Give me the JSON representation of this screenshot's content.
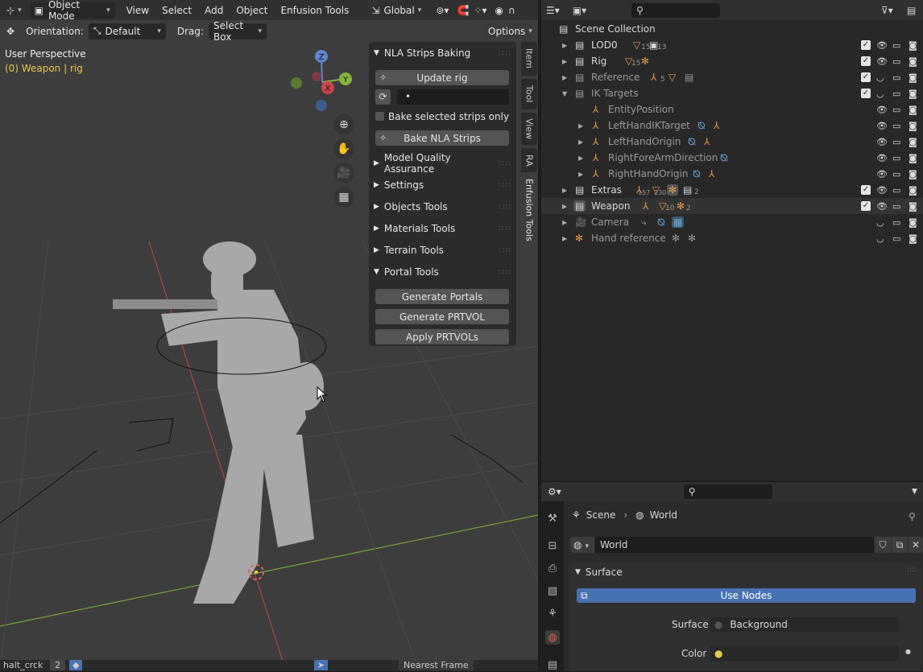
{
  "viewport": {
    "menus": [
      "View",
      "Select",
      "Add",
      "Object",
      "Enfusion Tools"
    ],
    "mode": "Object Mode",
    "transform_orientation": "Global",
    "tool": {
      "orientation_label": "Orientation:",
      "orientation_value": "Default",
      "drag_label": "Drag:",
      "drag_value": "Select Box",
      "options": "Options"
    },
    "perspective": "User Perspective",
    "active_object": "(0) Weapon | rig",
    "gizmo": {
      "x": "X",
      "y": "Y",
      "z": "Z"
    }
  },
  "npanel": {
    "nla_header": "NLA Strips Baking",
    "update_rig": "Update rig",
    "field_value": "•",
    "bake_selected": "Bake selected strips only",
    "bake_nla": "Bake NLA Strips",
    "sections": [
      "Model Quality Assurance",
      "Settings",
      "Objects Tools",
      "Materials Tools",
      "Terrain Tools"
    ],
    "portal_header": "Portal Tools",
    "portal_buttons": [
      "Generate Portals",
      "Generate PRTVOL",
      "Apply PRTVOLs"
    ]
  },
  "side_tabs": [
    "Item",
    "Tool",
    "View",
    "RA",
    "Enfusion Tools"
  ],
  "outliner": {
    "scene_collection": "Scene Collection",
    "rows": [
      {
        "label": "LOD0",
        "badges": [
          "15",
          "13"
        ]
      },
      {
        "label": "Rig",
        "badges": [
          "15"
        ]
      },
      {
        "label": "Reference",
        "badges": [
          "5"
        ]
      },
      {
        "label": "IK Targets",
        "badges": []
      },
      {
        "label": "EntityPosition",
        "badges": []
      },
      {
        "label": "LeftHandIKTarget",
        "badges": []
      },
      {
        "label": "LeftHandOrigin",
        "badges": []
      },
      {
        "label": "RightForeArmDirection",
        "badges": []
      },
      {
        "label": "RightHandOrigin",
        "badges": []
      },
      {
        "label": "Extras",
        "badges": [
          "157",
          "230",
          "2"
        ]
      },
      {
        "label": "Weapon",
        "badges": [
          "10",
          "2"
        ]
      },
      {
        "label": "Camera",
        "badges": []
      },
      {
        "label": "Hand reference",
        "badges": []
      }
    ]
  },
  "properties": {
    "breadcrumb_scene": "Scene",
    "breadcrumb_world": "World",
    "world_name": "World",
    "surface_header": "Surface",
    "use_nodes": "Use Nodes",
    "surface_label": "Surface",
    "surface_value": "Background",
    "color_label": "Color"
  },
  "bottom_strip": {
    "text": "halt_crck",
    "frame_value": "2",
    "interp": "Nearest Frame"
  },
  "colors": {
    "accent_blue": "#4772b3",
    "active_yellow": "#e8c84c",
    "object_orange": "#e59a4b"
  }
}
